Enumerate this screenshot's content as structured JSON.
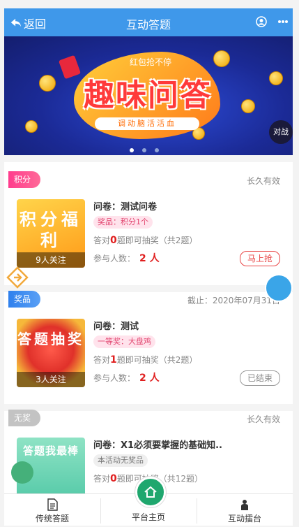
{
  "header": {
    "back_label": "返回",
    "title": "互动答题"
  },
  "banner": {
    "sub": "红包抢不停",
    "main": "趣味问答",
    "tagline": "调动脑活活血",
    "battle_label": "对战",
    "pages": 3,
    "active_page": 1
  },
  "cards": [
    {
      "tag": "积分",
      "validity": "长久有效",
      "thumb_text": "积分福利",
      "followers": "9人关注",
      "title": "问卷：测试问卷",
      "prize": "奖品：积分1个",
      "rule_prefix": "答对",
      "rule_count": "0",
      "rule_suffix": "题即可抽奖（共2题）",
      "people_label": "参与人数：",
      "people_count": "2 人",
      "action": "马上抢"
    },
    {
      "tag": "奖品",
      "validity": "截止：2020年07月31日",
      "thumb_text": "答题抽奖",
      "followers": "3人关注",
      "title": "问卷：测试",
      "prize": "一等奖：大盘鸡",
      "rule_prefix": "答对",
      "rule_count": "1",
      "rule_suffix": "题即可抽奖（共2题）",
      "people_label": "参与人数：",
      "people_count": "2 人",
      "action": "已结束"
    },
    {
      "tag": "无奖",
      "validity": "长久有效",
      "thumb_text": "答题我最棒",
      "followers": "",
      "title": "问卷：X1必须要掌握的基础知..",
      "prize": "本活动无奖品",
      "rule_prefix": "答对",
      "rule_count": "0",
      "rule_suffix": "题即可抽奖（共12题）",
      "people_label": "",
      "people_count": "",
      "action": ""
    }
  ],
  "nav": {
    "left": "传统答题",
    "center": "平台主页",
    "right": "互动擂台"
  },
  "colors": {
    "header": "#3f98ea",
    "tag_points": "#ff3c8d",
    "tag_prize": "#2f80ed",
    "tag_none": "#c3c3c3",
    "highlight": "#e02020",
    "home": "#1fa76e"
  }
}
